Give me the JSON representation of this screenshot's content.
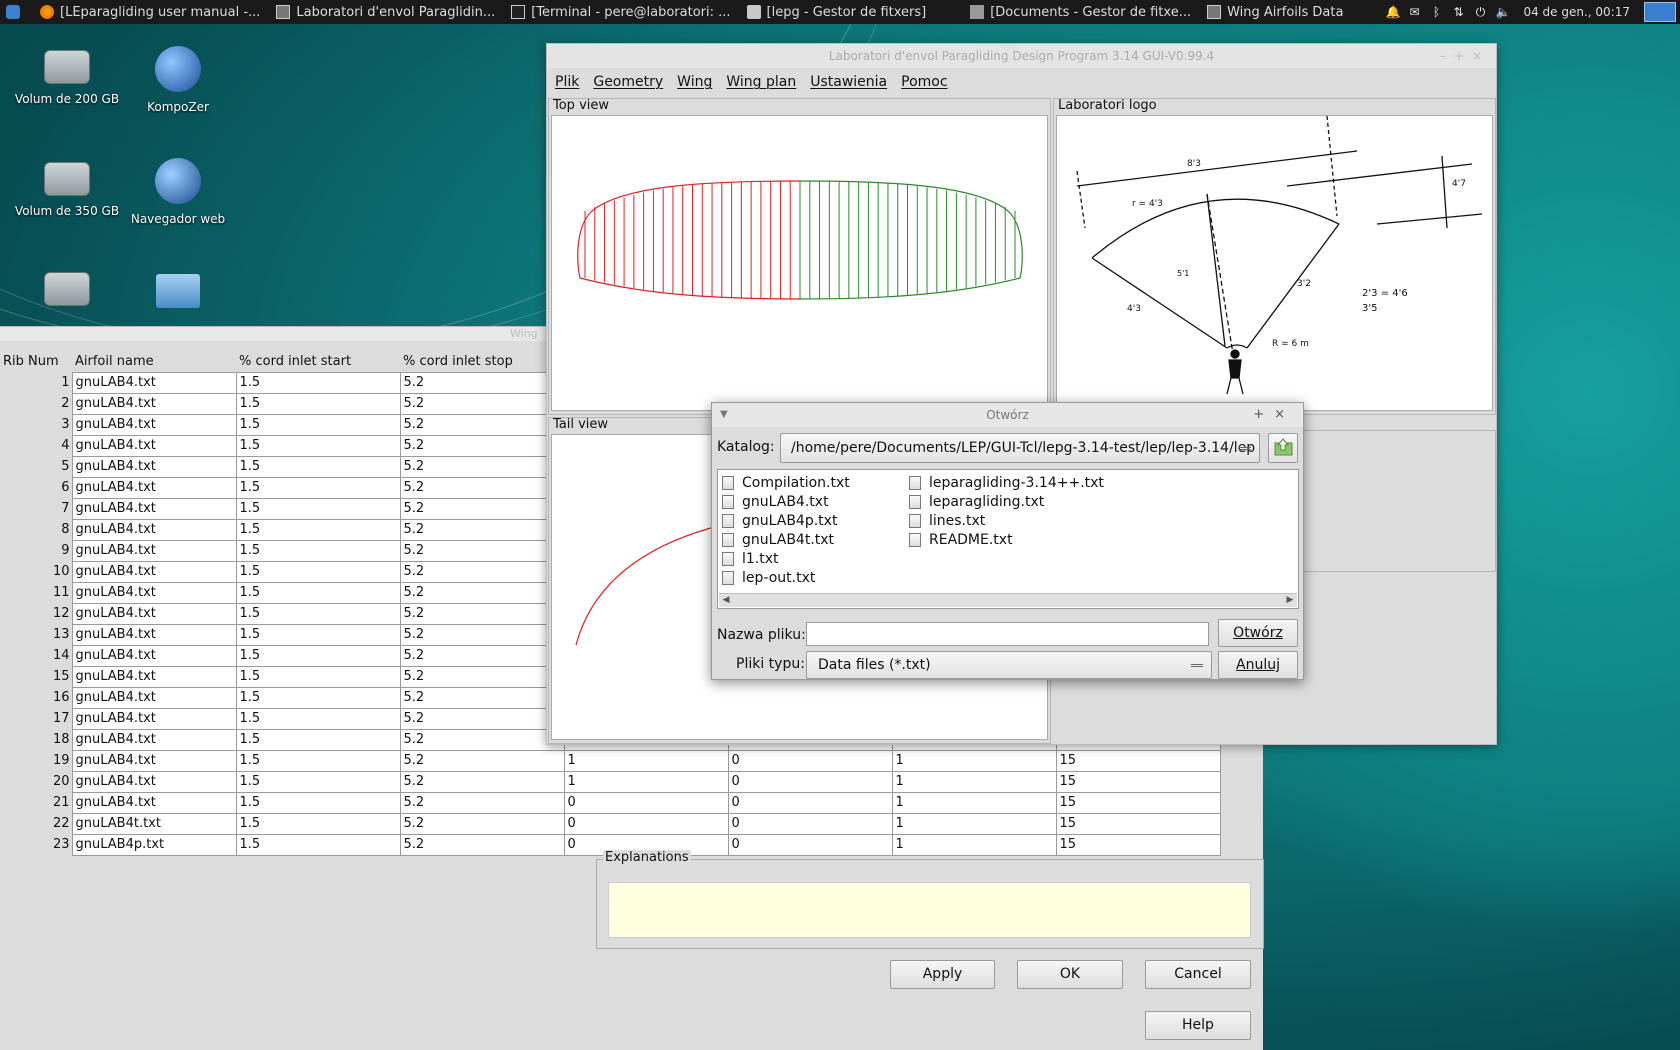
{
  "taskbar": {
    "tasks": [
      "[LEparagliding user manual -...",
      "Laboratori d'envol Paraglidin...",
      "[Terminal - pere@laboratori: ...",
      "[lepg - Gestor de fitxers]",
      "[Documents - Gestor de fitxe...",
      "Wing Airfoils Data"
    ],
    "clock": "04 de gen., 00:17"
  },
  "desktop": {
    "icons": [
      "Volum de 200 GB",
      "KompoZer",
      "Volum de 350 GB",
      "Navegador web"
    ]
  },
  "main_window": {
    "title": "Laboratori d'envol Paragliding Design Program 3.14 GUI-V0.99.4",
    "menu": [
      "Plik",
      "Geometry",
      "Wing",
      "Wing plan",
      "Ustawienia",
      "Pomoc"
    ],
    "panels": {
      "top_view": "Top view",
      "logo": "Laboratori logo",
      "tail_view": "Tail view"
    }
  },
  "wing_window": {
    "title": "Wing",
    "headers": [
      "Rib Num",
      "Airfoil name",
      "% cord inlet start",
      "% cord inlet stop"
    ],
    "rows": [
      [
        "1",
        "gnuLAB4.txt",
        "1.5",
        "5.2",
        "",
        "",
        "",
        ""
      ],
      [
        "2",
        "gnuLAB4.txt",
        "1.5",
        "5.2",
        "",
        "",
        "",
        ""
      ],
      [
        "3",
        "gnuLAB4.txt",
        "1.5",
        "5.2",
        "",
        "",
        "",
        ""
      ],
      [
        "4",
        "gnuLAB4.txt",
        "1.5",
        "5.2",
        "",
        "",
        "",
        ""
      ],
      [
        "5",
        "gnuLAB4.txt",
        "1.5",
        "5.2",
        "",
        "",
        "",
        ""
      ],
      [
        "6",
        "gnuLAB4.txt",
        "1.5",
        "5.2",
        "",
        "",
        "",
        ""
      ],
      [
        "7",
        "gnuLAB4.txt",
        "1.5",
        "5.2",
        "",
        "",
        "",
        ""
      ],
      [
        "8",
        "gnuLAB4.txt",
        "1.5",
        "5.2",
        "",
        "",
        "",
        ""
      ],
      [
        "9",
        "gnuLAB4.txt",
        "1.5",
        "5.2",
        "",
        "",
        "",
        ""
      ],
      [
        "10",
        "gnuLAB4.txt",
        "1.5",
        "5.2",
        "",
        "",
        "",
        ""
      ],
      [
        "11",
        "gnuLAB4.txt",
        "1.5",
        "5.2",
        "",
        "",
        "",
        ""
      ],
      [
        "12",
        "gnuLAB4.txt",
        "1.5",
        "5.2",
        "",
        "",
        "",
        ""
      ],
      [
        "13",
        "gnuLAB4.txt",
        "1.5",
        "5.2",
        "",
        "",
        "",
        ""
      ],
      [
        "14",
        "gnuLAB4.txt",
        "1.5",
        "5.2",
        "",
        "",
        "",
        ""
      ],
      [
        "15",
        "gnuLAB4.txt",
        "1.5",
        "5.2",
        "",
        "",
        "",
        ""
      ],
      [
        "16",
        "gnuLAB4.txt",
        "1.5",
        "5.2",
        "",
        "",
        "",
        ""
      ],
      [
        "17",
        "gnuLAB4.txt",
        "1.5",
        "5.2",
        "",
        "",
        "",
        ""
      ],
      [
        "18",
        "gnuLAB4.txt",
        "1.5",
        "5.2",
        "",
        "",
        "",
        ""
      ],
      [
        "19",
        "gnuLAB4.txt",
        "1.5",
        "5.2",
        "1",
        "0",
        "1",
        "15"
      ],
      [
        "20",
        "gnuLAB4.txt",
        "1.5",
        "5.2",
        "1",
        "0",
        "1",
        "15"
      ],
      [
        "21",
        "gnuLAB4.txt",
        "1.5",
        "5.2",
        "0",
        "0",
        "1",
        "15"
      ],
      [
        "22",
        "gnuLAB4t.txt",
        "1.5",
        "5.2",
        "0",
        "0",
        "1",
        "15"
      ],
      [
        "23",
        "gnuLAB4p.txt",
        "1.5",
        "5.2",
        "0",
        "0",
        "1",
        "15"
      ]
    ],
    "explanations_label": "Explanations",
    "buttons": {
      "apply": "Apply",
      "ok": "OK",
      "cancel": "Cancel",
      "help": "Help"
    }
  },
  "open_dialog": {
    "title": "Otwórz",
    "catalog_label": "Katalog:",
    "catalog_path": "/home/pere/Documents/LEP/GUI-Tcl/lepg-3.14-test/lep/lep-3.14/lep",
    "files_col1": [
      "Compilation.txt",
      "gnuLAB4.txt",
      "gnuLAB4p.txt",
      "gnuLAB4t.txt",
      "l1.txt",
      "lep-out.txt"
    ],
    "files_col2": [
      "leparagliding-3.14++.txt",
      "leparagliding.txt",
      "lines.txt",
      "README.txt"
    ],
    "filename_label": "Nazwa pliku:",
    "filename_value": "",
    "filetype_label": "Pliki typu:",
    "filetype_value": "Data files (*.txt)",
    "open_button": "Otwórz",
    "cancel_button": "Anuluj"
  },
  "colors": {
    "left_half": "#dd2222",
    "right_half": "#2a8a2a",
    "explain_bg": "#ffffe0"
  }
}
